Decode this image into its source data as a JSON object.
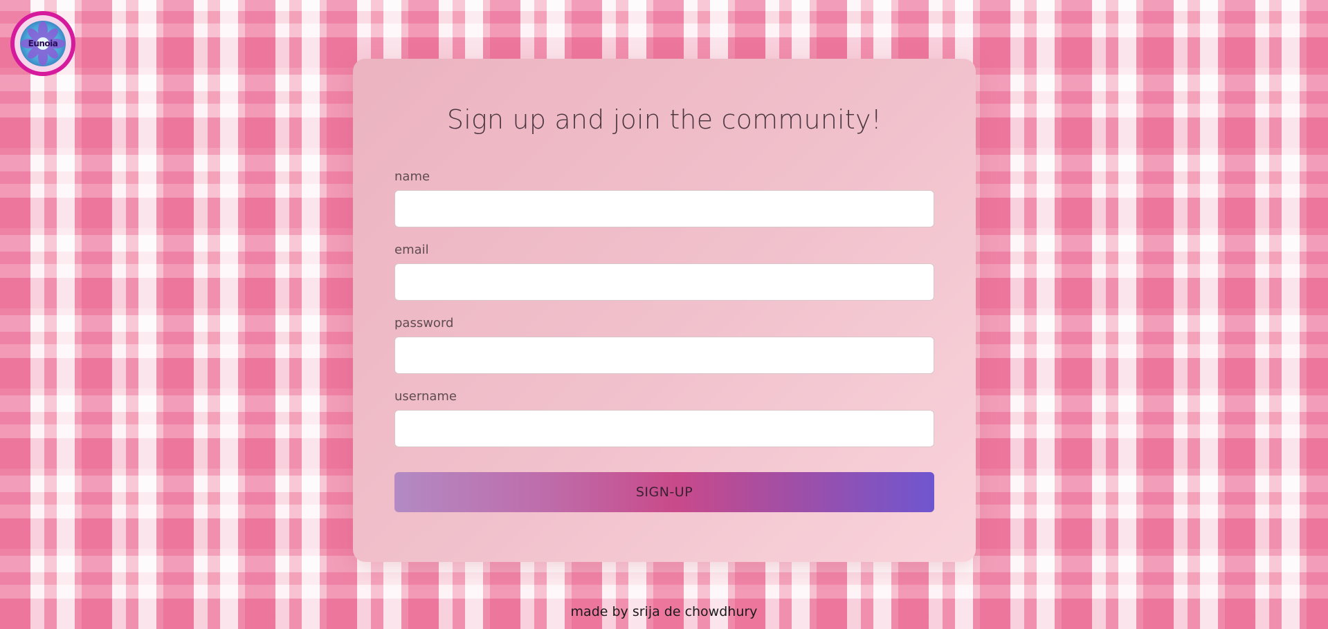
{
  "logo": {
    "text": "Eunoia",
    "icon": "flower-logo-icon",
    "ring_color": "#d61a9c"
  },
  "form": {
    "title": "Sign up and join the community!",
    "fields": [
      {
        "label": "name",
        "value": "",
        "placeholder": ""
      },
      {
        "label": "email",
        "value": "",
        "placeholder": ""
      },
      {
        "label": "password",
        "value": "",
        "placeholder": ""
      },
      {
        "label": "username",
        "value": "",
        "placeholder": ""
      }
    ],
    "submit_label": "SIGN-UP"
  },
  "footer": {
    "credit": "made by srija de chowdhury"
  },
  "colors": {
    "background": "#f8c6d4",
    "card": "#f0c0cb",
    "button_start": "#b38ac4",
    "button_mid": "#c94a8a",
    "button_end": "#6f56cf"
  }
}
